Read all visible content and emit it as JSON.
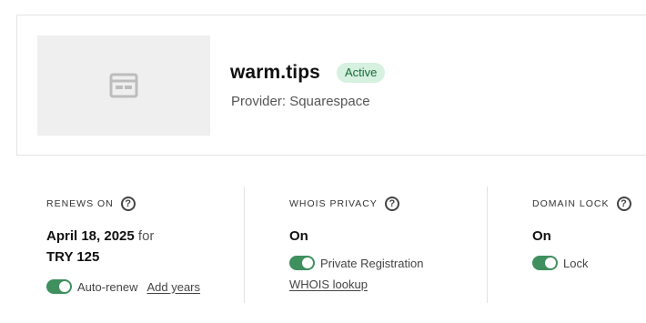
{
  "domain": {
    "name": "warm.tips",
    "status": "Active",
    "provider": "Provider: Squarespace",
    "thumbnail_icon": "website-placeholder-icon"
  },
  "renews": {
    "title": "RENEWS ON",
    "help": "?",
    "date": "April 18, 2025",
    "for_text": "for",
    "price": "TRY 125",
    "toggle_label": "Auto-renew",
    "toggle_on": true,
    "add_years": "Add years"
  },
  "whois": {
    "title": "WHOIS PRIVACY",
    "help": "?",
    "value": "On",
    "toggle_label": "Private Registration",
    "toggle_on": true,
    "lookup": "WHOIS lookup"
  },
  "lock": {
    "title": "DOMAIN LOCK",
    "help": "?",
    "value": "On",
    "toggle_label": "Lock",
    "toggle_on": true
  },
  "colors": {
    "toggle_on": "#3f8f5f",
    "badge_bg": "#d6f1df",
    "badge_text": "#17693a"
  }
}
